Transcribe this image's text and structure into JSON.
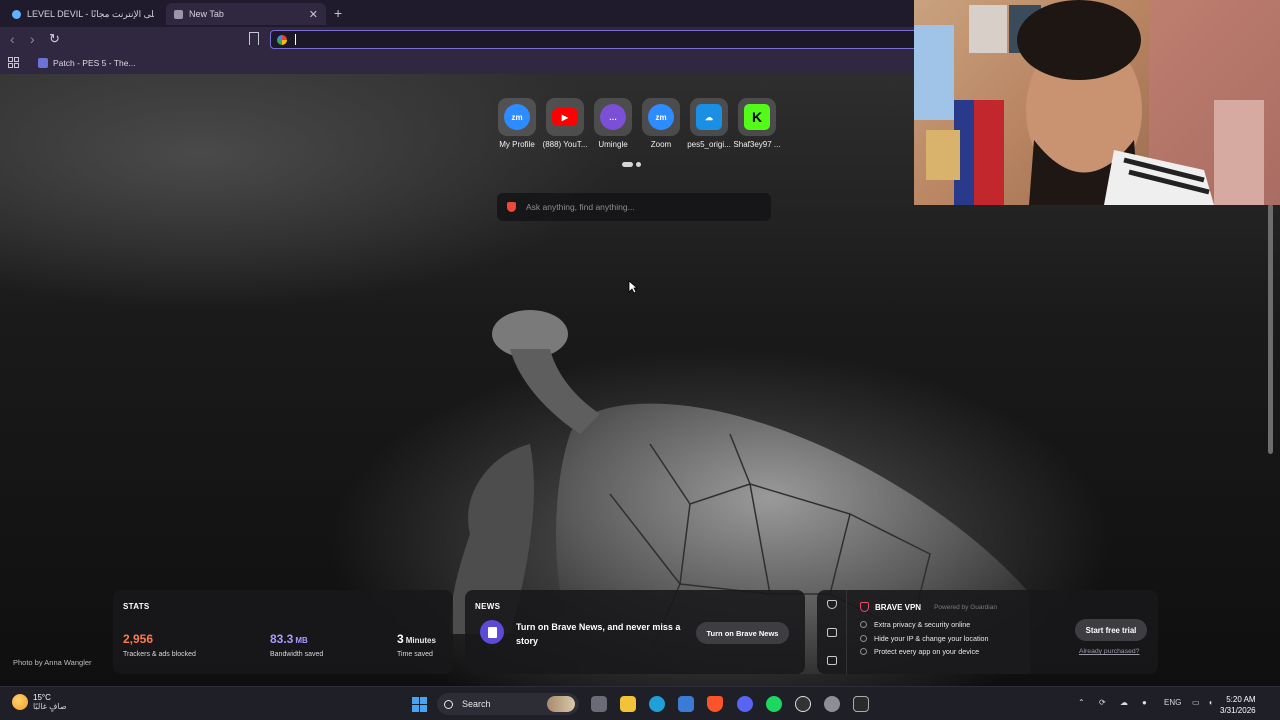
{
  "browser": {
    "tabs": [
      {
        "title": "LEVEL DEVIL - العب على الإنترنت مجانًا",
        "active": false
      },
      {
        "title": "New Tab",
        "active": true
      }
    ],
    "omnibox": {
      "value": ""
    },
    "bookmarks": [
      {
        "label": "Patch - PES 5 - The..."
      }
    ]
  },
  "new_tab": {
    "top_sites": [
      {
        "label": "My Profile",
        "icon": "zm-icon",
        "color": "#2d8cff",
        "glyph": "zm"
      },
      {
        "label": "(888) YouT...",
        "icon": "youtube-icon",
        "color": "#ff0000",
        "glyph": "▶"
      },
      {
        "label": "Umingle",
        "icon": "chat-bubble-icon",
        "color": "#7b4fd6",
        "glyph": "…"
      },
      {
        "label": "Zoom",
        "icon": "zm-icon",
        "color": "#2d8cff",
        "glyph": "zm"
      },
      {
        "label": "pes5_origi...",
        "icon": "cloud-icon",
        "color": "#1a8fe3",
        "glyph": "☁"
      },
      {
        "label": "Shaf3ey97 ...",
        "icon": "kick-icon",
        "color": "#53fc18",
        "glyph": "K"
      }
    ],
    "search_placeholder": "Ask anything, find anything...",
    "photo_credit": "Photo by Anna Wangler"
  },
  "stats": {
    "title": "STATS",
    "trackers": {
      "value": "2,956",
      "label": "Trackers & ads blocked",
      "color": "#fb7a52"
    },
    "bandwidth": {
      "value": "83.3",
      "unit": "MB",
      "label": "Bandwidth saved",
      "color": "#a89bff"
    },
    "time": {
      "value": "3",
      "unit": "Minutes",
      "label": "Time saved",
      "color": "#ffffff"
    }
  },
  "news": {
    "title": "NEWS",
    "text": "Turn on Brave News, and never miss a story",
    "button": "Turn on Brave News"
  },
  "vpn": {
    "name": "BRAVE VPN",
    "powered": "Powered by Guardian",
    "features": [
      "Extra privacy & security online",
      "Hide your IP & change your location",
      "Protect every app on your device"
    ],
    "button": "Start free trial",
    "link": "Already purchased?"
  },
  "taskbar": {
    "weather_temp": "15°C",
    "weather_cond": "صافٍ غالبًا",
    "search": "Search",
    "language": "ENG",
    "time": "5:20 AM",
    "date": "3/31/2026"
  }
}
